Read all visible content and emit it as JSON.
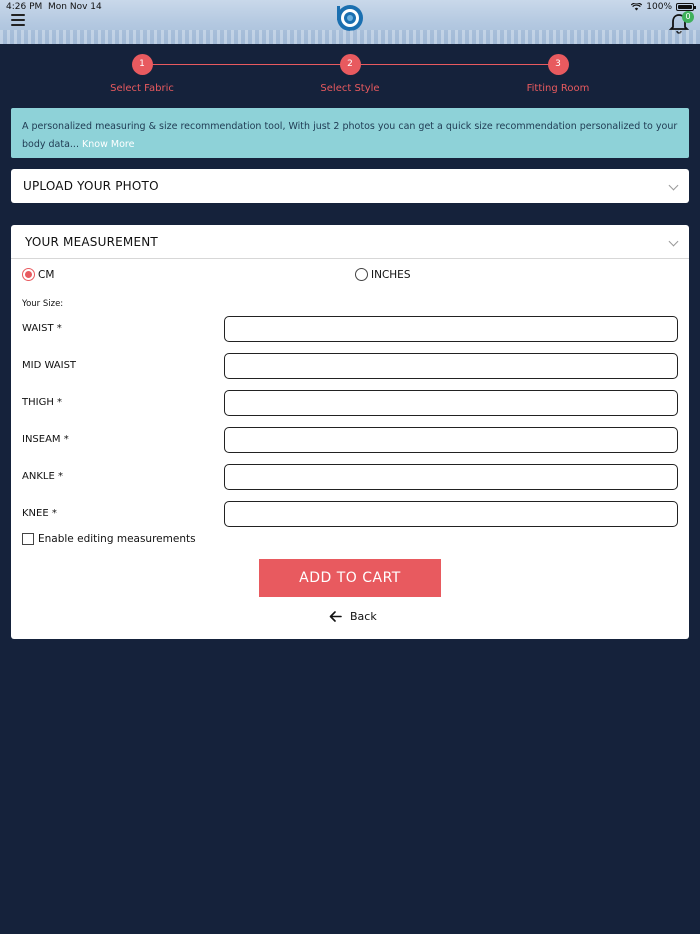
{
  "status": {
    "time": "4:26 PM",
    "date": "Mon Nov 14",
    "battery": "100%"
  },
  "header": {
    "notification_count": "0"
  },
  "stepper": [
    {
      "number": "1",
      "label": "Select Fabric"
    },
    {
      "number": "2",
      "label": "Select Style"
    },
    {
      "number": "3",
      "label": "Fitting Room"
    }
  ],
  "info": {
    "text": "A personalized measuring & size recommendation tool, With just 2 photos you can get a quick size recommendation personalized to your body data...",
    "link": "Know More"
  },
  "upload_panel": {
    "title": "UPLOAD YOUR PHOTO"
  },
  "measurement_panel": {
    "title": "YOUR MEASUREMENT",
    "units": [
      "CM",
      "INCHES"
    ],
    "selected_unit": "CM",
    "your_size_label": "Your Size:",
    "fields": [
      {
        "label": "WAIST *",
        "value": ""
      },
      {
        "label": "MID WAIST",
        "value": ""
      },
      {
        "label": "THIGH *",
        "value": ""
      },
      {
        "label": "INSEAM *",
        "value": ""
      },
      {
        "label": "ANKLE *",
        "value": ""
      },
      {
        "label": "KNEE *",
        "value": ""
      }
    ],
    "enable_editing_label": "Enable editing measurements",
    "add_to_cart": "ADD TO CART",
    "back": "Back"
  },
  "colors": {
    "accent": "#e85a5f",
    "background": "#15223b",
    "info_bg": "#8ed2d8",
    "badge": "#3eb05b"
  }
}
